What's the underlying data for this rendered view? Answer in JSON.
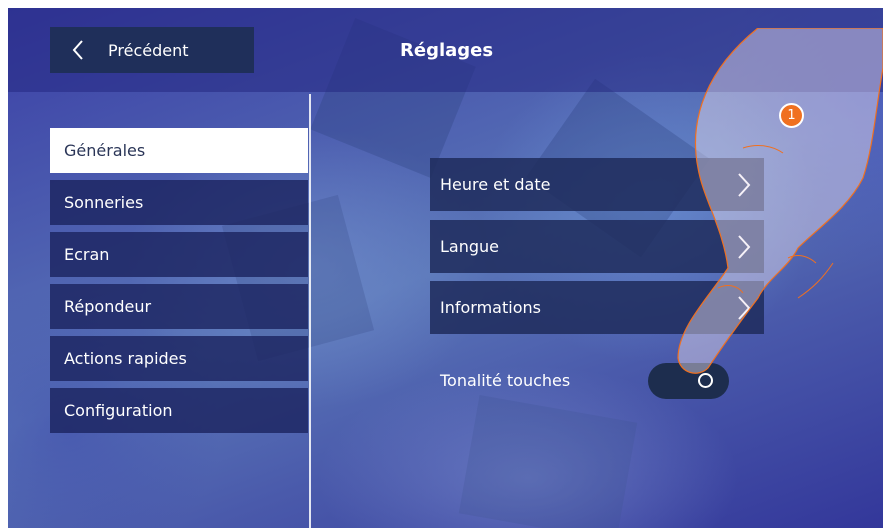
{
  "header": {
    "back_label": "Précédent",
    "title": "Réglages"
  },
  "sidebar": {
    "items": [
      {
        "label": "Générales",
        "active": true
      },
      {
        "label": "Sonneries",
        "active": false
      },
      {
        "label": "Ecran",
        "active": false
      },
      {
        "label": "Répondeur",
        "active": false
      },
      {
        "label": "Actions rapides",
        "active": false
      },
      {
        "label": "Configuration",
        "active": false
      }
    ]
  },
  "main": {
    "rows": [
      {
        "label": "Heure et date"
      },
      {
        "label": "Langue"
      },
      {
        "label": "Informations"
      }
    ],
    "toggle": {
      "label": "Tonalité touches",
      "state": "off"
    }
  },
  "annotation": {
    "step": "1"
  },
  "colors": {
    "accent": "#f07020",
    "panel": "#1f2f5a"
  }
}
